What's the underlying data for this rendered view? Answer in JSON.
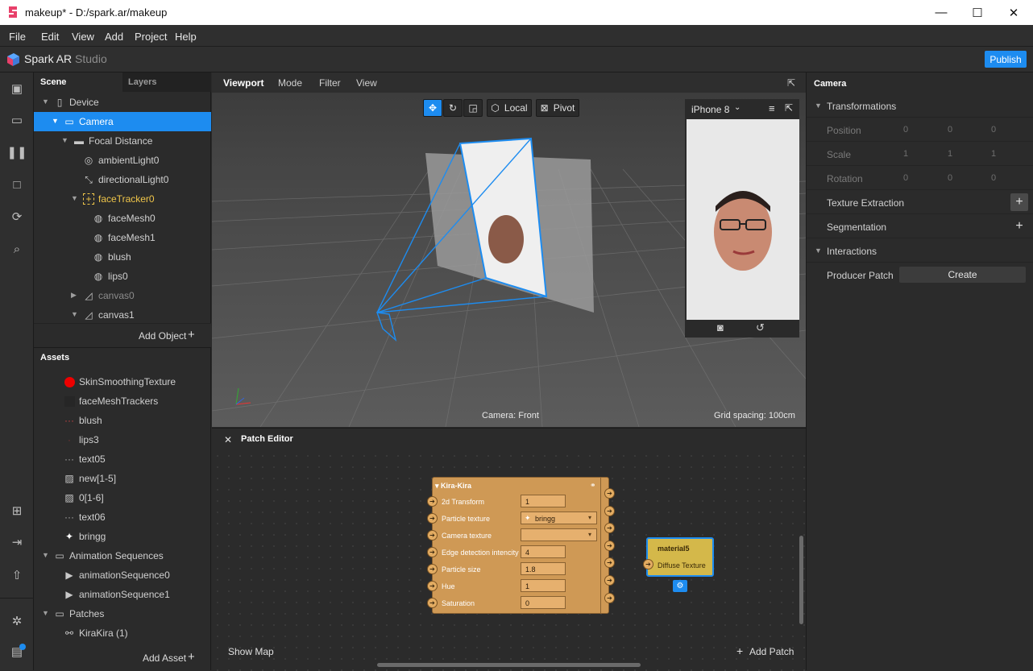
{
  "window": {
    "title": "makeup* - D:/spark.ar/makeup",
    "minimize": "—",
    "maximize": "☐",
    "close": "✕"
  },
  "menu": [
    "File",
    "Edit",
    "View",
    "Add",
    "Project",
    "Help"
  ],
  "brand": {
    "name": "Spark AR",
    "suffix": "Studio",
    "publish": "Publish",
    "accent": "#1d8cf0"
  },
  "scene": {
    "tabs": [
      "Scene",
      "Layers"
    ],
    "items": [
      {
        "label": "Device",
        "icon": "device-icon"
      },
      {
        "label": "Camera",
        "icon": "camera-icon",
        "selected": true
      },
      {
        "label": "Focal Distance",
        "icon": "focal-distance-icon"
      },
      {
        "label": "ambientLight0",
        "icon": "ambient-light-icon"
      },
      {
        "label": "directionalLight0",
        "icon": "directional-light-icon"
      },
      {
        "label": "faceTracker0",
        "icon": "face-tracker-icon"
      },
      {
        "label": "faceMesh0",
        "icon": "mesh-icon"
      },
      {
        "label": "faceMesh1",
        "icon": "mesh-icon"
      },
      {
        "label": "blush",
        "icon": "mesh-icon"
      },
      {
        "label": "lips0",
        "icon": "mesh-icon"
      },
      {
        "label": "canvas0",
        "icon": "canvas-icon"
      },
      {
        "label": "canvas1",
        "icon": "canvas-icon"
      }
    ],
    "add_object": "Add Object"
  },
  "assets": {
    "title": "Assets",
    "items": [
      {
        "label": "SkinSmoothingTexture",
        "icon": "texture-icon"
      },
      {
        "label": "faceMeshTrackers",
        "icon": "material-icon"
      },
      {
        "label": "blush",
        "icon": "material-icon"
      },
      {
        "label": "lips3",
        "icon": "material-icon"
      },
      {
        "label": "text05",
        "icon": "material-icon"
      },
      {
        "label": "new[1-5]",
        "icon": "image-icon"
      },
      {
        "label": "0[1-6]",
        "icon": "image-icon"
      },
      {
        "label": "text06",
        "icon": "material-icon"
      },
      {
        "label": "bringg",
        "icon": "sparkle-icon"
      },
      {
        "label": "Animation Sequences",
        "icon": "folder-icon"
      },
      {
        "label": "animationSequence0",
        "icon": "animation-icon"
      },
      {
        "label": "animationSequence1",
        "icon": "animation-icon"
      },
      {
        "label": "Patches",
        "icon": "folder-icon"
      },
      {
        "label": "KiraKira (1)",
        "icon": "patch-icon"
      }
    ],
    "add_asset": "Add Asset"
  },
  "viewport": {
    "tabs": [
      "Viewport",
      "Mode",
      "Filter",
      "View"
    ],
    "local": "Local",
    "pivot": "Pivot",
    "camera_label": "Camera: Front",
    "grid_label": "Grid spacing: 100cm",
    "device": "iPhone 8"
  },
  "patch_editor": {
    "title": "Patch Editor",
    "show_map": "Show Map",
    "add_patch": "Add Patch",
    "kira": {
      "title": "Kira-Kira",
      "params": [
        {
          "name": "2d Transform",
          "value": "1"
        },
        {
          "name": "Particle texture",
          "value": "bringg"
        },
        {
          "name": "Camera texture",
          "value": ""
        },
        {
          "name": "Edge detection intencity",
          "value": "4"
        },
        {
          "name": "Particle size",
          "value": "1.8"
        },
        {
          "name": "Hue",
          "value": "1"
        },
        {
          "name": "Saturation",
          "value": "0"
        }
      ]
    },
    "material": {
      "title": "material5",
      "port": "Diffuse Texture"
    }
  },
  "inspector": {
    "title": "Camera",
    "transformations": "Transformations",
    "position": {
      "label": "Position",
      "values": [
        "0",
        "0",
        "0"
      ]
    },
    "scale": {
      "label": "Scale",
      "values": [
        "1",
        "1",
        "1"
      ]
    },
    "rotation": {
      "label": "Rotation",
      "values": [
        "0",
        "0",
        "0"
      ]
    },
    "texture_extraction": "Texture Extraction",
    "segmentation": "Segmentation",
    "interactions": "Interactions",
    "producer_patch": "Producer Patch",
    "create": "Create"
  }
}
